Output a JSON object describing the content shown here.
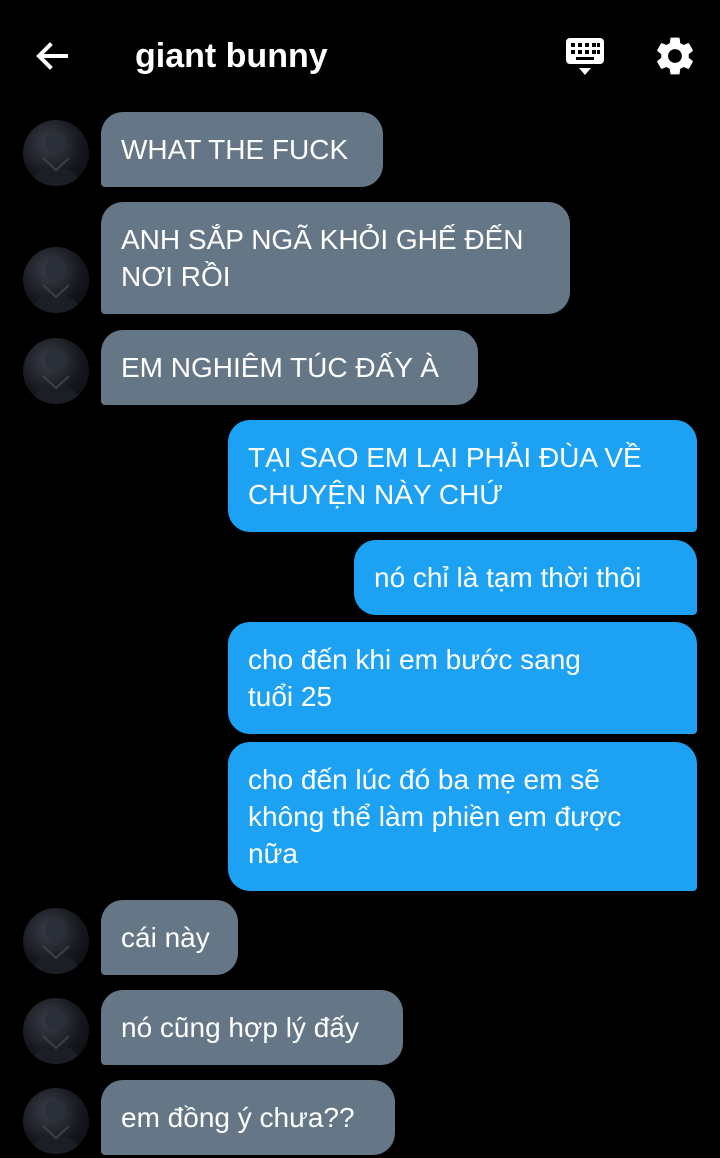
{
  "header": {
    "title": "giant bunny"
  },
  "messages": [
    {
      "from": "them",
      "text": "WHAT THE FUCK"
    },
    {
      "from": "them",
      "text": "ANH SẮP NGÃ KHỎI GHẾ ĐẾN\nNƠI RỒI"
    },
    {
      "from": "them",
      "text": "EM NGHIÊM TÚC ĐẤY À"
    },
    {
      "from": "me",
      "text": "TẠI SAO EM LẠI PHẢI ĐÙA VỀ\nCHUYỆN NÀY CHỨ"
    },
    {
      "from": "me",
      "text": "nó chỉ là tạm thời thôi"
    },
    {
      "from": "me",
      "text": "cho đến khi em bước sang\ntuổi 25"
    },
    {
      "from": "me",
      "text": "cho đến lúc đó ba mẹ em sẽ\nkhông thể làm phiền em được\nnữa"
    },
    {
      "from": "them",
      "text": "cái này"
    },
    {
      "from": "them",
      "text": "nó cũng hợp lý đấy"
    },
    {
      "from": "them",
      "text": "em đồng ý chưa??"
    }
  ],
  "colors": {
    "incoming": "#657786",
    "outgoing": "#1da1f2",
    "background": "#000000"
  },
  "icons": [
    "back-arrow-icon",
    "keyboard-icon",
    "gear-icon"
  ]
}
